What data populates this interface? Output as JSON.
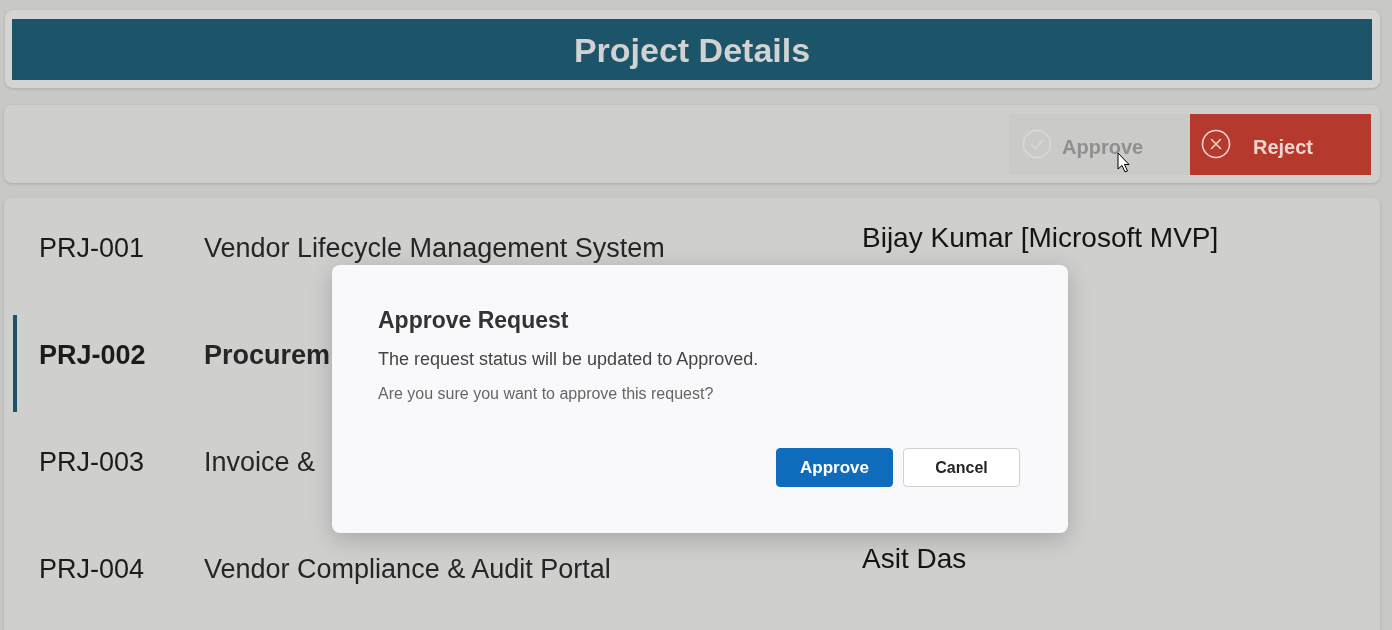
{
  "header": {
    "title": "Project Details"
  },
  "toolbar": {
    "buttons": [
      {
        "label": "Approve",
        "kind": "approve",
        "disabled": true
      },
      {
        "label": "Reject",
        "kind": "reject",
        "disabled": false
      }
    ]
  },
  "projects": [
    {
      "id": "PRJ-001",
      "name": "Vendor Lifecycle Management System",
      "owner": "Bijay Kumar [Microsoft MVP]",
      "selected": false
    },
    {
      "id": "PRJ-002",
      "name": "Procurem",
      "selected": true
    },
    {
      "id": "PRJ-003",
      "name": "Invoice &",
      "selected": false
    },
    {
      "id": "PRJ-004",
      "name": "Vendor Compliance & Audit Portal",
      "owner": "Asit Das",
      "selected": false
    }
  ],
  "dialog": {
    "title": "Approve Request",
    "message": "The request status will be updated to Approved.",
    "question": "Are you sure you want to approve this request?",
    "buttons": [
      {
        "label": "Approve",
        "kind": "primary"
      },
      {
        "label": "Cancel",
        "kind": "secondary"
      }
    ]
  }
}
